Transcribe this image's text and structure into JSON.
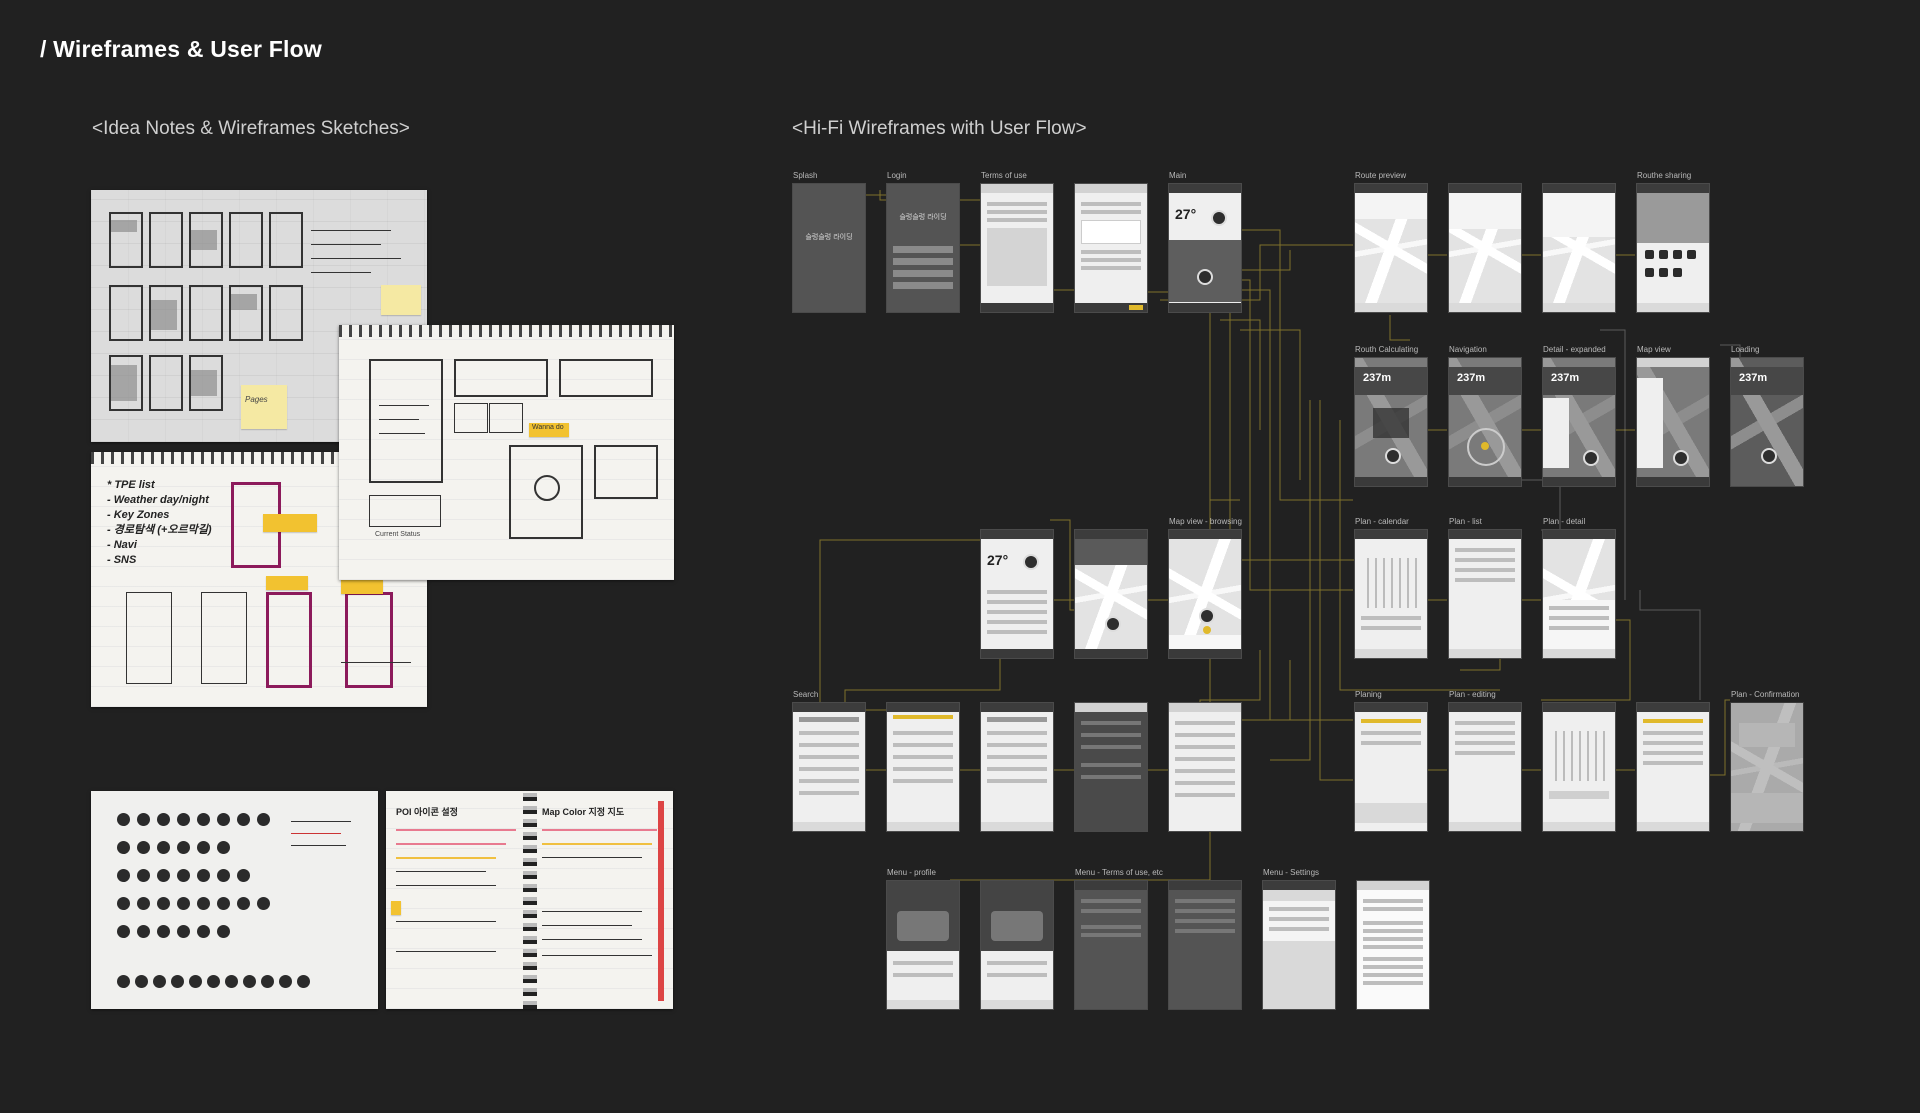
{
  "page": {
    "title": "/ Wireframes & User Flow",
    "left_section_title": "<Idea Notes & Wireframes Sketches>",
    "right_section_title": "<Hi-Fi Wireframes with User Flow>"
  },
  "colors": {
    "background": "#212121",
    "accent_yellow": "#e0b92b",
    "flow_line": "#8a7a2e",
    "postit": "#f2c230",
    "sketch_magenta": "#8c1a5b"
  },
  "sketches": {
    "sketch1_note": "Pages",
    "sketch2_notes": {
      "tag1": "Wanna do",
      "tag2": "Current Status"
    },
    "sketch3_list": [
      "* TPE list",
      "- Weather day/night",
      "- Key Zones",
      "- 경로탐색 (+오르막길)",
      "- Navi",
      "- SNS"
    ],
    "sketch6_title": "POI 아이콘 설정",
    "sketch6_right_title": "Map Color 지정 지도"
  },
  "screens": {
    "row1": [
      {
        "label": "Splash",
        "logo": "슬렁슬렁 라이딩"
      },
      {
        "label": "Login",
        "logo": "슬렁슬렁 라이딩"
      },
      {
        "label": "Terms of use"
      },
      {
        "label": ""
      },
      {
        "label": "Main",
        "temp": "27°"
      }
    ],
    "row1_right": [
      {
        "label": "Route preview"
      },
      {
        "label": ""
      },
      {
        "label": ""
      },
      {
        "label": "Routhe sharing"
      }
    ],
    "row2_right": [
      {
        "label": "Routh Calculating",
        "distance": "237m"
      },
      {
        "label": "Navigation",
        "distance": "237m"
      },
      {
        "label": "Detail - expanded",
        "distance": "237m"
      },
      {
        "label": "Map view"
      },
      {
        "label": "Loading",
        "distance": "237m"
      }
    ],
    "row3": [
      {
        "label": "",
        "temp": "27°"
      },
      {
        "label": ""
      },
      {
        "label": "Map view - browsing"
      }
    ],
    "row3_right": [
      {
        "label": "Plan - calendar"
      },
      {
        "label": "Plan - list"
      },
      {
        "label": "Plan - detail"
      }
    ],
    "row4": [
      {
        "label": "Search"
      },
      {
        "label": ""
      },
      {
        "label": ""
      },
      {
        "label": ""
      },
      {
        "label": ""
      }
    ],
    "row4_right": [
      {
        "label": "Planing"
      },
      {
        "label": "Plan - editing"
      },
      {
        "label": ""
      },
      {
        "label": ""
      },
      {
        "label": "Plan - Confirmation"
      }
    ],
    "row5": [
      {
        "label": "Menu - profile"
      },
      {
        "label": ""
      },
      {
        "label": "Menu - Terms of use, etc"
      },
      {
        "label": ""
      },
      {
        "label": "Menu - Settings"
      },
      {
        "label": ""
      }
    ]
  }
}
